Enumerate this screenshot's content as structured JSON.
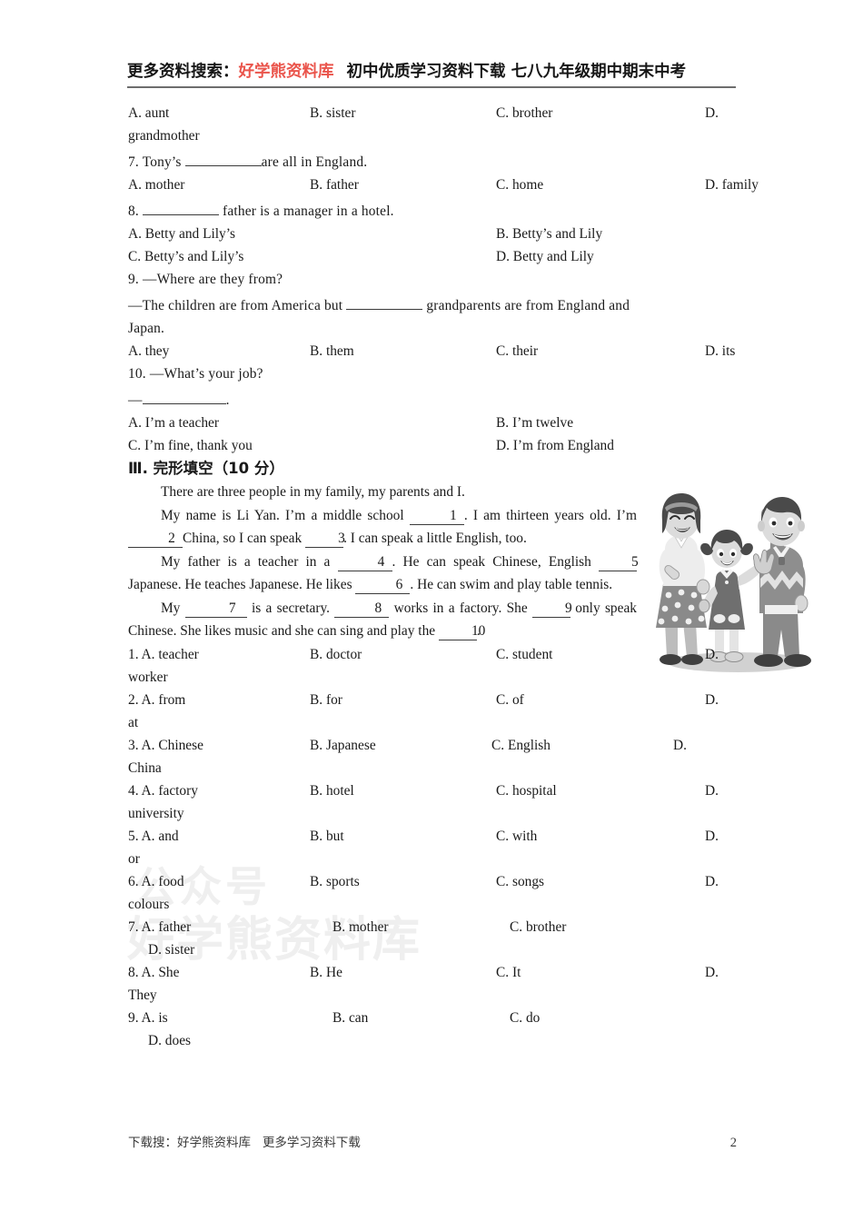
{
  "header": {
    "prefix": "更多资料搜索：",
    "brand": "好学熊资料库",
    "subtitle": "初中优质学习资料下载 七八九年级期中期末中考",
    "brand_color": "#ea554c",
    "rule_color": "#6d6d6d"
  },
  "watermark": {
    "line1": "公众号",
    "line2": "好学熊资料库",
    "color": "#efefef"
  },
  "multiple_choice": {
    "q6_options": {
      "a": "A. aunt",
      "b": "B. sister",
      "c": "C. brother",
      "d": "D.",
      "d_wrap": "grandmother"
    },
    "q7": {
      "number": "7. ",
      "stem_before": "Tony’s ",
      "blank": "",
      "stem_after": "are all in England.",
      "a": "A. mother",
      "b": "B. father",
      "c": "C. home",
      "d": "D. family"
    },
    "q8": {
      "number": "8. ",
      "stem_before": "",
      "blank": "",
      "stem_after": " father is a manager in a hotel.",
      "a": "A. Betty and Lily’s",
      "b": "B. Betty’s and Lily",
      "c": "C. Betty’s and Lily’s",
      "d": "D. Betty and Lily"
    },
    "q9": {
      "line1": "9. —Where are they from?",
      "line2_before": "—The children are from America but ",
      "line2_blank": "",
      "line2_after": " grandparents are from England and",
      "line3": "Japan.",
      "a": "A. they",
      "b": "B. them",
      "c": "C. their",
      "d": "D. its"
    },
    "q10": {
      "line1": "10. —What’s your job?",
      "line2_dash": "—",
      "line2_blank": "",
      "line2_after": ".",
      "a": "A. I’m a teacher",
      "b": "B. I’m twelve",
      "c": "C. I’m fine, thank you",
      "d": "D. I’m from England"
    }
  },
  "section3": {
    "heading": "Ⅲ. 完形填空（10 分）",
    "para1": "There are three people in my family, my parents and I.",
    "para2": {
      "seg1": "My name is Li Yan. I’m a middle school ",
      "blank1": "1",
      "seg2": ". I am thirteen years old. I’m ",
      "blank2": "2",
      "seg3": "China, so I can speak  ",
      "blank3": "3",
      "seg4": ". I can speak a little English, too."
    },
    "para3": {
      "seg1": "My father is a teacher in a ",
      "blank4": "4",
      "seg2": ". He can speak Chinese, English ",
      "blank5": "5",
      "seg3": " Japanese. He teaches Japanese. He likes ",
      "blank6": "6",
      "seg4": ". He can swim and play table tennis."
    },
    "para4": {
      "seg1": "My ",
      "blank7": "7",
      "seg2": " is a secretary. ",
      "blank8": "8",
      "seg3": " works in a factory. She ",
      "blank9": "9",
      "seg4": " only speak Chinese. She likes music and she can sing and play the ",
      "blank10": "10",
      "seg5": "."
    },
    "illustration": {
      "name": "family-illustration",
      "description": "Grayscale cartoon of a mother, a young girl and a waving father"
    },
    "options": [
      {
        "num": "1. ",
        "a": "A. teacher",
        "b": "B. doctor",
        "c": "C. student",
        "d": "D.",
        "d_wrap": "worker"
      },
      {
        "num": "2. ",
        "a": "A. from",
        "b": "B. for",
        "c": "C. of",
        "d": "D.",
        "d_wrap": "at"
      },
      {
        "num": "3. ",
        "a": "A. Chinese",
        "b": "B. Japanese",
        "c": "C. English",
        "d": "D.",
        "d_wrap": "China"
      },
      {
        "num": "4. ",
        "a": "A. factory",
        "b": "B. hotel",
        "c": "C. hospital",
        "d": "D.",
        "d_wrap": "university"
      },
      {
        "num": "5. ",
        "a": "A. and",
        "b": "B. but",
        "c": "C. with",
        "d": "D.",
        "d_wrap": "or"
      },
      {
        "num": "6. ",
        "a": "A. food",
        "b": "B. sports",
        "c": "C. songs",
        "d": "D.",
        "d_wrap": "colours"
      },
      {
        "num": "7. ",
        "a": "A. father",
        "b": "B. mother",
        "c": "C. brother",
        "d": "",
        "d_wrap": "D. sister"
      },
      {
        "num": "8. ",
        "a": "A. She",
        "b": "B. He",
        "c": "C. It",
        "d": "D.",
        "d_wrap": "They"
      },
      {
        "num": "9. ",
        "a": "A. is",
        "b": "B. can",
        "c": "C. do",
        "d": "",
        "d_wrap": "D. does"
      }
    ]
  },
  "footer": {
    "text": "下载搜：好学熊资料库   更多学习资料下载",
    "page_number": "2"
  }
}
